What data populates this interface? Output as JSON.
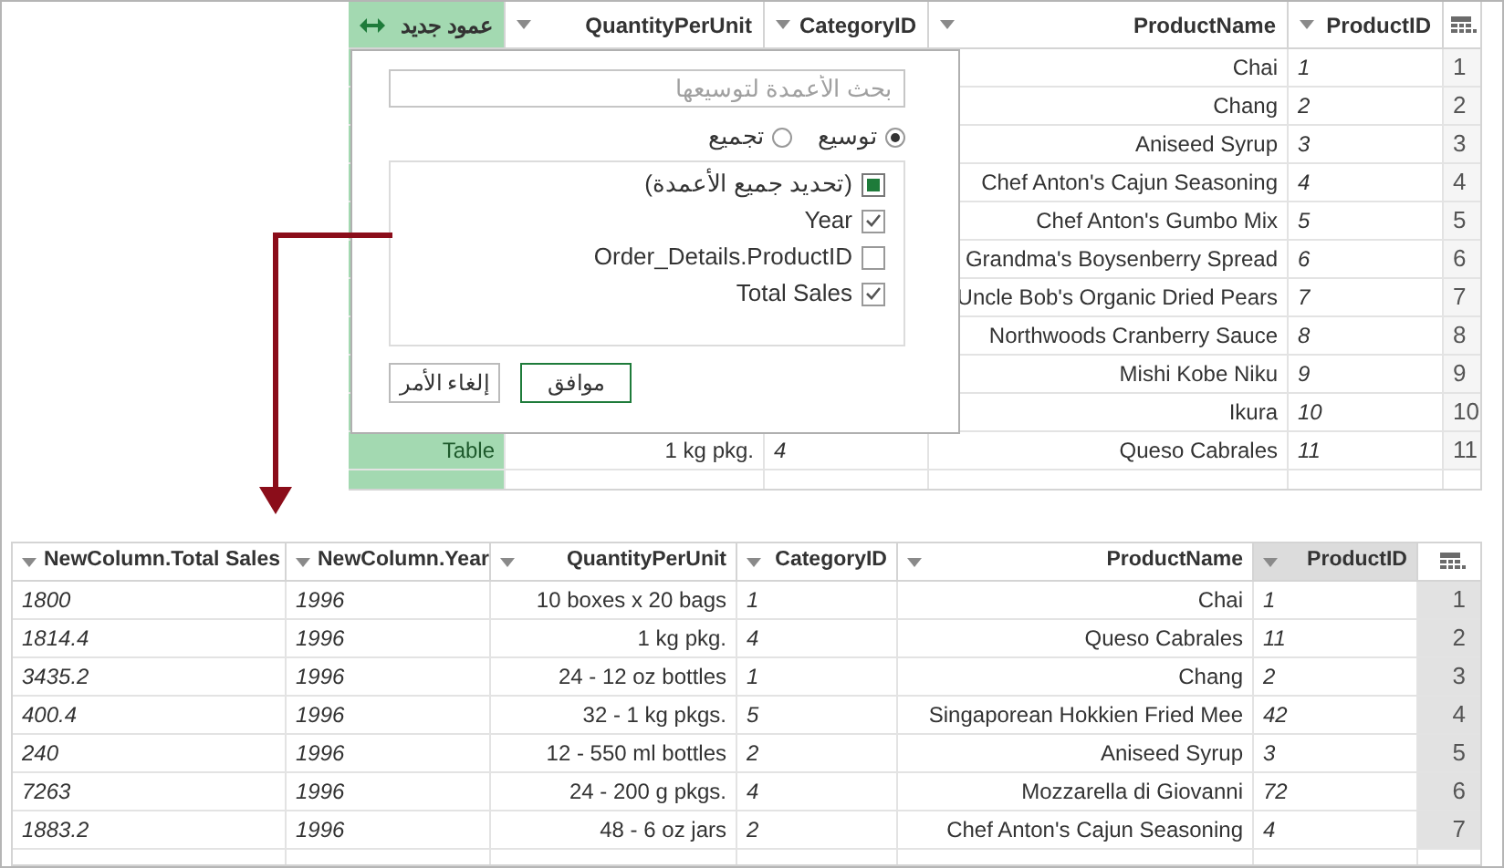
{
  "top_table": {
    "columns": [
      {
        "label": "عمود جديد",
        "kind": "expandable"
      },
      {
        "label": "QuantityPerUnit",
        "kind": "normal"
      },
      {
        "label": "CategoryID",
        "kind": "normal"
      },
      {
        "label": "ProductName",
        "kind": "normal"
      },
      {
        "label": "ProductID",
        "kind": "normal"
      }
    ],
    "rows": [
      {
        "product_name": "Chai",
        "product_id": "1",
        "row_number": "1"
      },
      {
        "product_name": "Chang",
        "product_id": "2",
        "row_number": "2"
      },
      {
        "product_name": "Aniseed Syrup",
        "product_id": "3",
        "row_number": "3"
      },
      {
        "product_name": "Chef Anton's Cajun Seasoning",
        "product_id": "4",
        "row_number": "4"
      },
      {
        "product_name": "Chef Anton's Gumbo Mix",
        "product_id": "5",
        "row_number": "5"
      },
      {
        "product_name": "Grandma's Boysenberry Spread",
        "product_id": "6",
        "row_number": "6"
      },
      {
        "product_name": "Uncle Bob's Organic Dried Pears",
        "product_id": "7",
        "row_number": "7"
      },
      {
        "product_name": "Northwoods Cranberry Sauce",
        "product_id": "8",
        "row_number": "8"
      },
      {
        "product_name": "Mishi Kobe Niku",
        "product_id": "9",
        "row_number": "9"
      },
      {
        "product_name": "Ikura",
        "product_id": "10",
        "row_number": "10"
      },
      {
        "new_column": "Table",
        "quantity_per_unit": "1 kg pkg.",
        "category_id": "4",
        "product_name": "Queso Cabrales",
        "product_id": "11",
        "row_number": "11"
      },
      {}
    ]
  },
  "expand_popup": {
    "search_placeholder": "بحث الأعمدة لتوسيعها",
    "modes": [
      {
        "label": "توسيع",
        "selected": true
      },
      {
        "label": "تجميع",
        "selected": false
      }
    ],
    "columns": [
      {
        "label": "(تحديد جميع الأعمدة)",
        "kind": "select_all",
        "checked": true
      },
      {
        "label": "Year",
        "kind": "column",
        "checked": true
      },
      {
        "label": "Order_Details.ProductID",
        "kind": "column",
        "checked": false
      },
      {
        "label": "Total Sales",
        "kind": "column",
        "checked": true
      }
    ],
    "buttons": [
      {
        "label": "موافق",
        "kind": "primary"
      },
      {
        "label": "إلغاء الأمر",
        "kind": "secondary"
      }
    ]
  },
  "bottom_table": {
    "columns": [
      {
        "label": "NewColumn.Total Sales",
        "selected": false
      },
      {
        "label": "NewColumn.Year",
        "selected": false
      },
      {
        "label": "QuantityPerUnit",
        "selected": false
      },
      {
        "label": "CategoryID",
        "selected": false
      },
      {
        "label": "ProductName",
        "selected": false
      },
      {
        "label": "ProductID",
        "selected": true
      }
    ],
    "rows": [
      {
        "total_sales": "1800",
        "year": "1996",
        "quantity_per_unit": "10 boxes x 20 bags",
        "category_id": "1",
        "product_name": "Chai",
        "product_id": "1",
        "row_number": "1"
      },
      {
        "total_sales": "1814.4",
        "year": "1996",
        "quantity_per_unit": "1 kg pkg.",
        "category_id": "4",
        "product_name": "Queso Cabrales",
        "product_id": "11",
        "row_number": "2"
      },
      {
        "total_sales": "3435.2",
        "year": "1996",
        "quantity_per_unit": "24 - 12 oz bottles",
        "category_id": "1",
        "product_name": "Chang",
        "product_id": "2",
        "row_number": "3"
      },
      {
        "total_sales": "400.4",
        "year": "1996",
        "quantity_per_unit": "32 - 1 kg pkgs.",
        "category_id": "5",
        "product_name": "Singaporean Hokkien Fried Mee",
        "product_id": "42",
        "row_number": "4"
      },
      {
        "total_sales": "240",
        "year": "1996",
        "quantity_per_unit": "12 - 550 ml bottles",
        "category_id": "2",
        "product_name": "Aniseed Syrup",
        "product_id": "3",
        "row_number": "5"
      },
      {
        "total_sales": "7263",
        "year": "1996",
        "quantity_per_unit": "24 - 200 g pkgs.",
        "category_id": "4",
        "product_name": "Mozzarella di Giovanni",
        "product_id": "72",
        "row_number": "6"
      },
      {
        "total_sales": "1883.2",
        "year": "1996",
        "quantity_per_unit": "48 - 6 oz jars",
        "category_id": "2",
        "product_name": "Chef Anton's Cajun Seasoning",
        "product_id": "4",
        "row_number": "7"
      }
    ]
  }
}
